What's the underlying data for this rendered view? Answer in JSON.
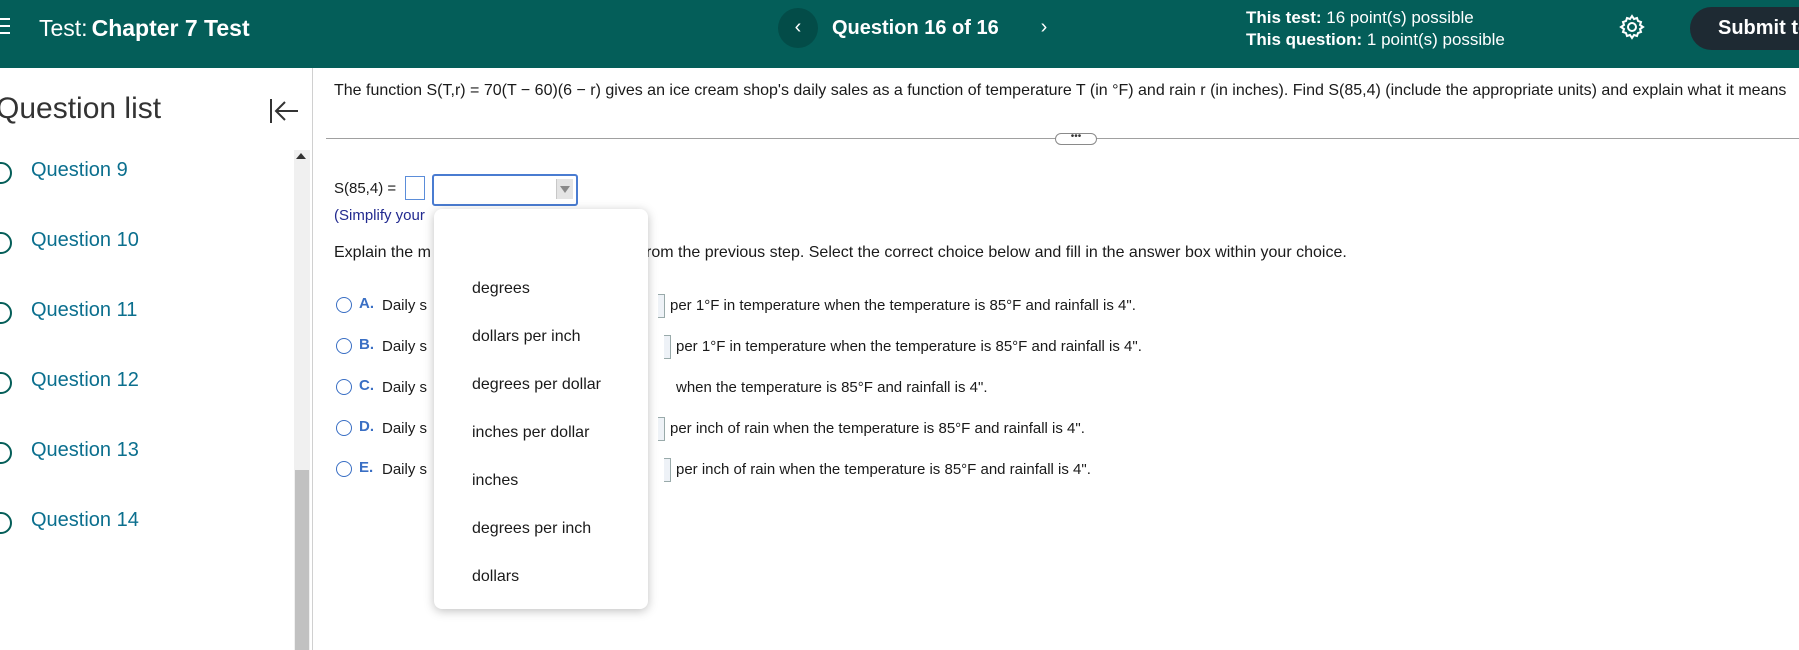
{
  "header": {
    "title_prefix": "Test:",
    "title_name": "Chapter 7 Test",
    "prev_label": "‹",
    "question_nav": "Question 16 of 16",
    "next_label": "›",
    "this_test_label": "This test:",
    "this_test_value": "16 point(s) possible",
    "this_question_label": "This question:",
    "this_question_value": "1 point(s) possible",
    "submit_label": "Submit te"
  },
  "sidebar": {
    "title": "Question list",
    "items": [
      {
        "label": "Question 9"
      },
      {
        "label": "Question 10"
      },
      {
        "label": "Question 11"
      },
      {
        "label": "Question 12"
      },
      {
        "label": "Question 13"
      },
      {
        "label": "Question 14"
      }
    ]
  },
  "main": {
    "question_text": "The function S(T,r) = 70(T − 60)(6 − r) gives an ice cream shop's daily sales as a function of temperature T (in °F) and rain r (in inches). Find S(85,4) (include the appropriate units) and explain what it means",
    "answer_label": "S(85,4) =",
    "simplify_text": "(Simplify your",
    "explain_text": "Explain the m",
    "explain_tail": "rom the previous step. Select the correct choice below and fill in the answer box within your choice.",
    "choices": [
      {
        "letter": "A.",
        "start": "Daily s",
        "tail": "per 1°F in temperature when the temperature is 85°F and rainfall is 4\"."
      },
      {
        "letter": "B.",
        "start": "Daily s",
        "tail": "per 1°F in temperature when the temperature is 85°F and rainfall is 4\"."
      },
      {
        "letter": "C.",
        "start": "Daily s",
        "tail": "when the temperature is 85°F and rainfall is 4\"."
      },
      {
        "letter": "D.",
        "start": "Daily s",
        "tail": "per inch of rain when the temperature is 85°F and rainfall is 4\"."
      },
      {
        "letter": "E.",
        "start": "Daily s",
        "tail": "per inch of rain when the temperature is 85°F and rainfall is 4\"."
      }
    ]
  },
  "dropdown": {
    "options": [
      "degrees",
      "dollars per inch",
      "degrees per dollar",
      "inches per dollar",
      "inches",
      "degrees per inch",
      "dollars"
    ]
  },
  "colors": {
    "header_bg": "#045e59",
    "submit_bg": "#1e2a33",
    "link": "#0b6f8e",
    "choice_accent": "#3a6fc4"
  }
}
